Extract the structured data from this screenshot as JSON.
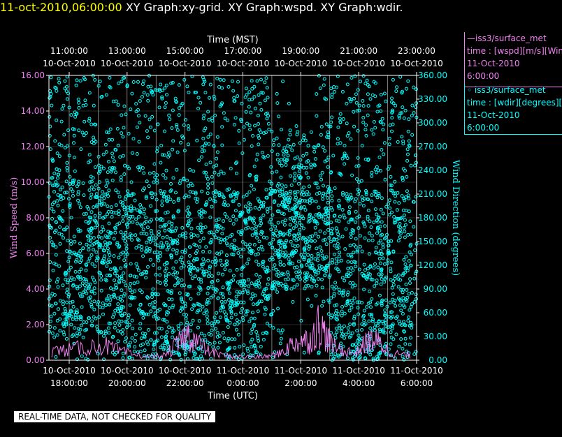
{
  "header": {
    "timestamp": "11-oct-2010,06:00:00",
    "title": "XY Graph:xy-grid.  XY Graph:wspd.  XY Graph:wdir."
  },
  "legend": [
    {
      "series": "iss3/surface_met",
      "line1": "time : [wspd][m/s][Wind",
      "line2": "11-Oct-2010",
      "line3": "6:00:00",
      "color": "#ee82ee",
      "marker": "line"
    },
    {
      "series": "iss3/surface_met",
      "line1": "time : [wdir][degrees][W",
      "line2": "11-Oct-2010",
      "line3": "6:00:00",
      "color": "#00ffff",
      "marker": "circle"
    }
  ],
  "footer_note": "REAL-TIME DATA, NOT CHECKED FOR QUALITY",
  "chart_data": {
    "type": "scatter",
    "top_axis": {
      "label": "Time (MST)",
      "ticks": [
        {
          "time": "11:00:00",
          "date": "10-Oct-2010"
        },
        {
          "time": "13:00:00",
          "date": "10-Oct-2010"
        },
        {
          "time": "15:00:00",
          "date": "10-Oct-2010"
        },
        {
          "time": "17:00:00",
          "date": "10-Oct-2010"
        },
        {
          "time": "19:00:00",
          "date": "10-Oct-2010"
        },
        {
          "time": "21:00:00",
          "date": "10-Oct-2010"
        },
        {
          "time": "23:00:00",
          "date": "10-Oct-2010"
        }
      ]
    },
    "bottom_axis": {
      "label": "Time (UTC)",
      "ticks": [
        {
          "date": "10-Oct-2010",
          "time": "18:00:00"
        },
        {
          "date": "10-Oct-2010",
          "time": "20:00:00"
        },
        {
          "date": "10-Oct-2010",
          "time": "22:00:00"
        },
        {
          "date": "11-Oct-2010",
          "time": "0:00:00"
        },
        {
          "date": "11-Oct-2010",
          "time": "2:00:00"
        },
        {
          "date": "11-Oct-2010",
          "time": "4:00:00"
        },
        {
          "date": "11-Oct-2010",
          "time": "6:00:00"
        }
      ],
      "range_hours_utc": [
        17.3,
        30.0
      ]
    },
    "left_axis": {
      "label": "Wind Speed (m/s)",
      "ylim": [
        0,
        16
      ],
      "ticks": [
        "0.00",
        "2.00",
        "4.00",
        "6.00",
        "8.00",
        "10.00",
        "12.00",
        "14.00",
        "16.00"
      ],
      "color": "#ee82ee"
    },
    "right_axis": {
      "label": "Wind Direction (degrees)",
      "ylim": [
        0,
        360
      ],
      "ticks": [
        "0.00",
        "30.00",
        "60.00",
        "90.00",
        "120.00",
        "150.00",
        "180.00",
        "210.00",
        "240.00",
        "270.00",
        "300.00",
        "330.00",
        "360.00"
      ],
      "color": "#00ffff"
    },
    "grid": true,
    "series": [
      {
        "name": "wspd",
        "style": "line",
        "color": "#ee82ee",
        "approx_envelope": [
          {
            "x": 17.4,
            "y": 0.8
          },
          {
            "x": 18.0,
            "y": 0.9
          },
          {
            "x": 18.6,
            "y": 1.1
          },
          {
            "x": 19.2,
            "y": 1.3
          },
          {
            "x": 19.7,
            "y": 0.8
          },
          {
            "x": 20.2,
            "y": 0.5
          },
          {
            "x": 20.8,
            "y": 0.3
          },
          {
            "x": 21.3,
            "y": 0.4
          },
          {
            "x": 21.8,
            "y": 1.5
          },
          {
            "x": 22.1,
            "y": 2.2
          },
          {
            "x": 22.4,
            "y": 1.6
          },
          {
            "x": 22.8,
            "y": 0.8
          },
          {
            "x": 23.3,
            "y": 0.4
          },
          {
            "x": 23.8,
            "y": 0.3
          },
          {
            "x": 24.3,
            "y": 0.3
          },
          {
            "x": 24.8,
            "y": 0.3
          },
          {
            "x": 25.2,
            "y": 0.5
          },
          {
            "x": 25.6,
            "y": 1.2
          },
          {
            "x": 26.0,
            "y": 1.8
          },
          {
            "x": 26.3,
            "y": 1.6
          },
          {
            "x": 26.6,
            "y": 3.0
          },
          {
            "x": 26.8,
            "y": 2.4
          },
          {
            "x": 27.1,
            "y": 1.2
          },
          {
            "x": 27.5,
            "y": 0.8
          },
          {
            "x": 27.9,
            "y": 0.6
          },
          {
            "x": 28.2,
            "y": 1.4
          },
          {
            "x": 28.5,
            "y": 1.8
          },
          {
            "x": 28.8,
            "y": 1.3
          },
          {
            "x": 29.1,
            "y": 0.6
          },
          {
            "x": 29.5,
            "y": 0.5
          },
          {
            "x": 29.8,
            "y": 0.4
          }
        ]
      },
      {
        "name": "wdir",
        "style": "circles",
        "color": "#00ffff",
        "approx_clusters": [
          {
            "x_start": 17.3,
            "x_end": 19.5,
            "y_low": 30,
            "y_high": 360
          },
          {
            "x_start": 19.5,
            "x_end": 21.3,
            "y_low": 0,
            "y_high": 360
          },
          {
            "x_start": 21.3,
            "x_end": 22.5,
            "y_low": 0,
            "y_high": 360
          },
          {
            "x_start": 22.5,
            "x_end": 25.0,
            "y_low": 0,
            "y_high": 360
          },
          {
            "x_start": 25.0,
            "x_end": 27.0,
            "y_low": 90,
            "y_high": 300
          },
          {
            "x_start": 27.0,
            "x_end": 30.0,
            "y_low": 0,
            "y_high": 360
          }
        ]
      }
    ]
  }
}
